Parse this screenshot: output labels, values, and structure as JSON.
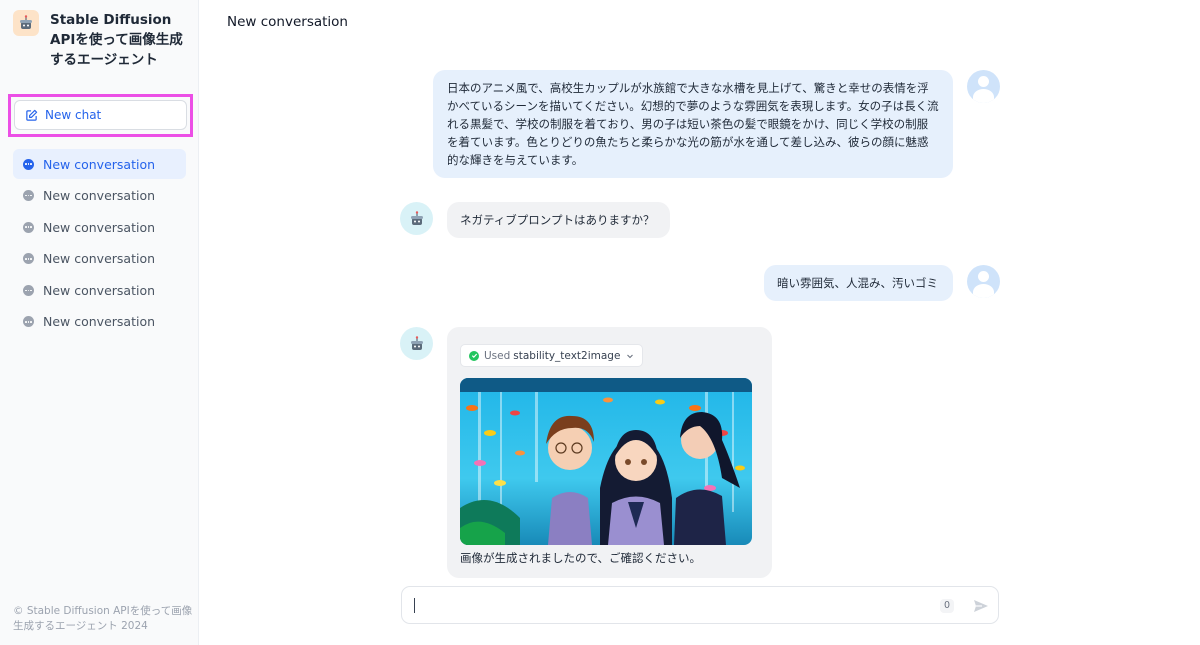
{
  "app": {
    "title": "Stable Diffusion APIを使って画像生成するエージェント"
  },
  "sidebar": {
    "new_chat_label": "New chat",
    "conversations": [
      {
        "label": "New conversation",
        "active": true
      },
      {
        "label": "New conversation",
        "active": false
      },
      {
        "label": "New conversation",
        "active": false
      },
      {
        "label": "New conversation",
        "active": false
      },
      {
        "label": "New conversation",
        "active": false
      },
      {
        "label": "New conversation",
        "active": false
      }
    ],
    "footer": "© Stable Diffusion APIを使って画像生成するエージェント 2024"
  },
  "header": {
    "title": "New conversation"
  },
  "messages": [
    {
      "role": "user",
      "text": "日本のアニメ風で、高校生カップルが水族館で大きな水槽を見上げて、驚きと幸せの表情を浮かべているシーンを描いてください。幻想的で夢のような雰囲気を表現します。女の子は長く流れる黒髪で、学校の制服を着ており、男の子は短い茶色の髪で眼鏡をかけ、同じく学校の制服を着ています。色とりどりの魚たちと柔らかな光の筋が水を通して差し込み、彼らの顔に魅惑的な輝きを与えています。"
    },
    {
      "role": "assistant",
      "text": "ネガティブプロンプトはありますか？"
    },
    {
      "role": "user",
      "text": "暗い雰囲気、人混み、汚いゴミ"
    },
    {
      "role": "assistant",
      "tool_used_prefix": "Used",
      "tool_name": "stability_text2image",
      "text": "画像が生成されましたので、ご確認ください。"
    }
  ],
  "composer": {
    "value": "",
    "placeholder": "",
    "char_count": "0"
  },
  "colors": {
    "accent": "#2563eb",
    "highlight": "#ec4fe6",
    "user_bubble": "#e6f0fc",
    "bot_bubble": "#f1f2f4"
  },
  "icons": {
    "logo": "robot-cake-icon",
    "new_chat": "edit-icon",
    "conversation": "chat-bubble-icon",
    "tool_status": "check-circle-icon",
    "send": "send-icon"
  }
}
